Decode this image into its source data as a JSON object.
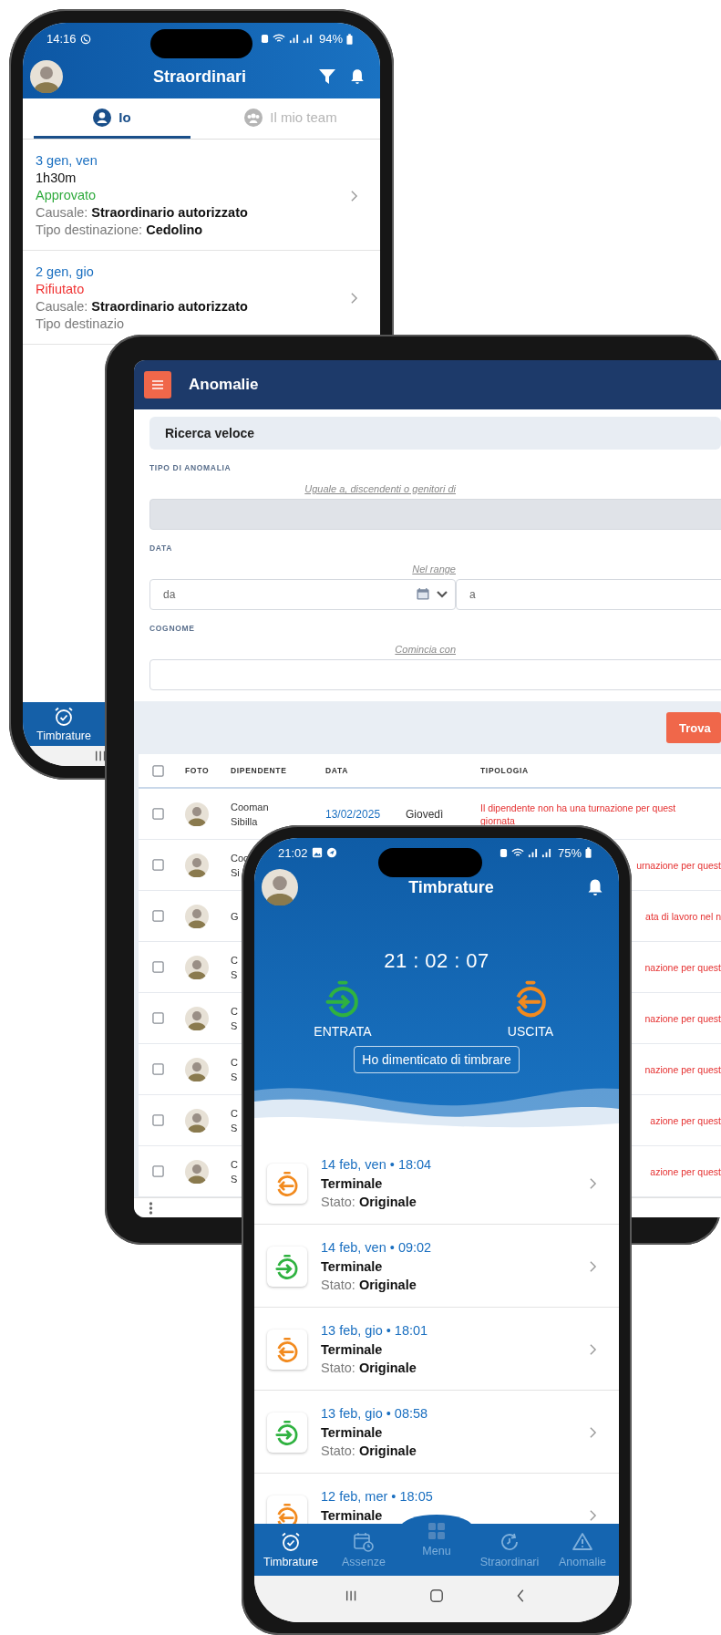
{
  "phone_straordinari": {
    "status_bar": {
      "time": "14:16",
      "battery": "94%"
    },
    "header": {
      "title": "Straordinari"
    },
    "tabs": [
      {
        "label": "Io",
        "selected": true,
        "kind": "person"
      },
      {
        "label": "Il mio team",
        "selected": false,
        "kind": "team"
      }
    ],
    "items": [
      {
        "date": "3 gen, ven",
        "duration": "1h30m",
        "status": {
          "text": "Approvato",
          "kind": "approved"
        },
        "causale_label": "Causale:",
        "causale": "Straordinario autorizzato",
        "dest_label": "Tipo destinazione:",
        "dest": "Cedolino"
      },
      {
        "date": "2 gen, gio",
        "status": {
          "text": "Rifiutato",
          "kind": "rejected"
        },
        "causale_label": "Causale:",
        "causale": "Straordinario autorizzato",
        "dest_label": "Tipo destinazio"
      }
    ],
    "bottom_nav": [
      {
        "label": "Timbrature",
        "selected": true,
        "kind": "alarm"
      }
    ]
  },
  "tablet_anomalie": {
    "header": {
      "title": "Anomalie"
    },
    "quick_search": "Ricerca veloce",
    "filters": [
      {
        "label": "TIPO DI ANOMALIA",
        "operator": "Uguale a, discendenti o genitori di",
        "kind": "select"
      },
      {
        "label": "DATA",
        "operator": "Nel range",
        "kind": "range",
        "from_placeholder": "da",
        "to_placeholder": "a"
      },
      {
        "label": "COGNOME",
        "operator": "Comincia con",
        "kind": "text"
      }
    ],
    "find_button": "Trova",
    "table": {
      "select_all": {
        "checked": false
      },
      "columns": [
        "FOTO",
        "DIPENDENTE",
        "DATA",
        "TIPOLOGIA"
      ],
      "rows": [
        {
          "kind": "full",
          "checked": false,
          "employee": [
            "Cooman",
            "Sibilla"
          ],
          "date": "13/02/2025",
          "day": "Giovedì",
          "type": [
            "Il dipendente non ha una turnazione per quest",
            "giornata"
          ]
        },
        {
          "kind": "covered",
          "checked": false,
          "employee": [
            "Coo",
            "Si"
          ],
          "type": [
            "urnazione per quest"
          ]
        },
        {
          "kind": "covered",
          "checked": false,
          "employee": [
            "G"
          ],
          "type": [
            "ata di lavoro nel n"
          ]
        },
        {
          "kind": "covered",
          "checked": false,
          "employee": [
            "C",
            "S"
          ],
          "type": [
            "nazione per quest"
          ]
        },
        {
          "kind": "covered",
          "checked": false,
          "employee": [
            "C",
            "S"
          ],
          "type": [
            "nazione per quest"
          ]
        },
        {
          "kind": "covered",
          "checked": false,
          "employee": [
            "C",
            "S"
          ],
          "type": [
            "nazione per quest"
          ]
        },
        {
          "kind": "covered",
          "checked": false,
          "employee": [
            "C",
            "S"
          ],
          "type": [
            "azione per quest"
          ]
        },
        {
          "kind": "covered",
          "checked": false,
          "employee": [
            "C",
            "S"
          ],
          "type": [
            "azione per quest"
          ]
        }
      ]
    }
  },
  "phone_timbrature": {
    "status_bar": {
      "time": "21:02",
      "battery": "75%"
    },
    "header": {
      "title": "Timbrature"
    },
    "clock": "21 : 02 : 07",
    "actions": [
      {
        "label": "ENTRATA",
        "kind": "in"
      },
      {
        "label": "USCITA",
        "kind": "out"
      }
    ],
    "forgot_button": "Ho dimenticato di timbrare",
    "entries": [
      {
        "kind": "out",
        "when": "14 feb, ven • 18:04",
        "source": "Terminale",
        "state_label": "Stato:",
        "state": "Originale"
      },
      {
        "kind": "in",
        "when": "14 feb, ven • 09:02",
        "source": "Terminale",
        "state_label": "Stato:",
        "state": "Originale"
      },
      {
        "kind": "out",
        "when": "13 feb, gio • 18:01",
        "source": "Terminale",
        "state_label": "Stato:",
        "state": "Originale"
      },
      {
        "kind": "in",
        "when": "13 feb, gio • 08:58",
        "source": "Terminale",
        "state_label": "Stato:",
        "state": "Originale"
      },
      {
        "kind": "out",
        "when": "12 feb, mer • 18:05",
        "source": "Terminale"
      }
    ],
    "bottom_nav": [
      {
        "label": "Timbrature",
        "selected": true,
        "kind": "alarm"
      },
      {
        "label": "Assenze",
        "selected": false,
        "kind": "calendar"
      },
      {
        "label": "Menu",
        "selected": false,
        "kind": "grid"
      },
      {
        "label": "Straordinari",
        "selected": false,
        "kind": "history"
      },
      {
        "label": "Anomalie",
        "selected": false,
        "kind": "warning"
      }
    ]
  }
}
